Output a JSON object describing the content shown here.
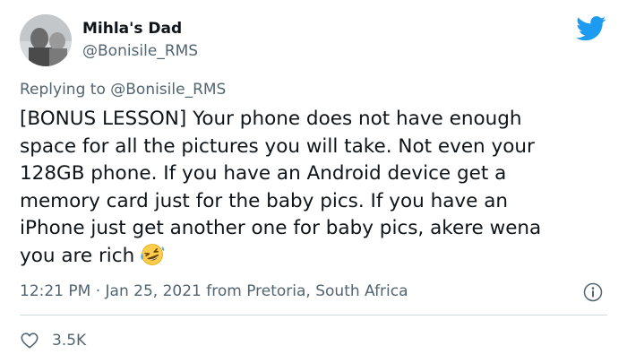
{
  "tweet": {
    "author_name": "Mihla's Dad",
    "author_handle": "@Bonisile_RMS",
    "replying_prefix": "Replying to",
    "replying_mention": "@Bonisile_RMS",
    "text_lines": [
      "[BONUS LESSON] Your phone does not have enough",
      "space for all the pictures you will take. Not even your",
      "128GB phone. If you have an Android device get a",
      "memory card just for the baby pics. If you have an",
      "iPhone just get another one for baby pics, akere wena",
      "you are rich"
    ],
    "emoji": "rolling-on-floor-laughing-emoji",
    "timestamp": "12:21 PM · Jan 25, 2021 from Pretoria, South Africa",
    "like_count": "3.5K"
  },
  "icons": {
    "brand": "twitter-bird-icon",
    "info": "info-icon",
    "like": "heart-icon"
  },
  "colors": {
    "twitter_blue": "#1d9bf0",
    "text_primary": "#0f1419",
    "text_secondary": "#536471",
    "divider": "#cfd9de"
  }
}
